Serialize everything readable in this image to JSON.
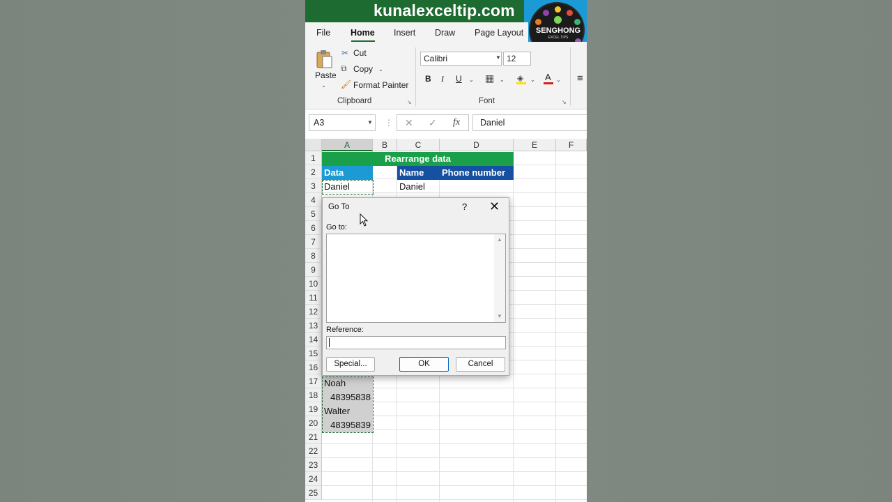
{
  "banner": {
    "site": "kunalexceltip.com",
    "logo_text": "SENGHONG",
    "logo_sub": "EXCEL TIPS"
  },
  "ribbon": {
    "tabs": [
      "File",
      "Home",
      "Insert",
      "Draw",
      "Page Layout"
    ],
    "active_tab": "Home",
    "clipboard": {
      "paste": "Paste",
      "cut": "Cut",
      "copy": "Copy",
      "format_painter": "Format Painter",
      "label": "Clipboard"
    },
    "font": {
      "name": "Calibri",
      "size": "12",
      "bold": "B",
      "italic": "I",
      "underline": "U",
      "label": "Font"
    }
  },
  "formula_bar": {
    "name_box": "A3",
    "fx": "fx",
    "value": "Daniel"
  },
  "grid": {
    "columns": [
      "A",
      "B",
      "C",
      "D",
      "E",
      "F"
    ],
    "rows": [
      "1",
      "2",
      "3",
      "4",
      "5",
      "6",
      "7",
      "8",
      "9",
      "10",
      "11",
      "12",
      "13",
      "14",
      "15",
      "16",
      "17",
      "18",
      "19",
      "20",
      "21",
      "22",
      "23",
      "24",
      "25"
    ],
    "title": "Rearrange data",
    "header_data": "Data",
    "header_name": "Name",
    "header_phone": "Phone number",
    "a3": "Daniel",
    "c3": "Daniel",
    "a17": "Noah",
    "a18": "48395838",
    "a19": "Walter",
    "a20": "48395839",
    "colors": {
      "title_bg": "#1aa04a",
      "header_data_bg": "#1b9ad6",
      "header_name_bg": "#1650a0"
    }
  },
  "dialog": {
    "title": "Go To",
    "help": "?",
    "goto_label": "Go to:",
    "reference_label": "Reference:",
    "reference_value": "",
    "special": "Special...",
    "ok": "OK",
    "cancel": "Cancel"
  }
}
